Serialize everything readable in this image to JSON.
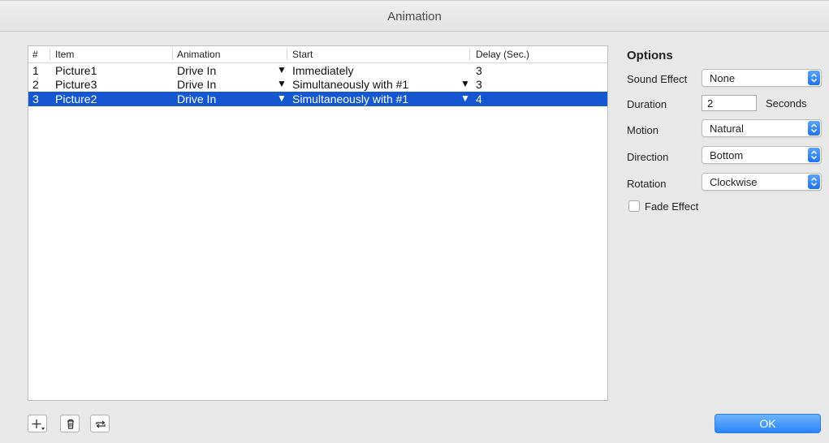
{
  "window": {
    "title": "Animation"
  },
  "table": {
    "columns": [
      "#",
      "Item",
      "Animation",
      "Start",
      "Delay (Sec.)"
    ],
    "rows": [
      {
        "num": "1",
        "item": "Picture1",
        "animation": "Drive In",
        "start": "Immediately",
        "delay": "3",
        "start_arrow": false,
        "selected": false
      },
      {
        "num": "2",
        "item": "Picture3",
        "animation": "Drive In",
        "start": "Simultaneously with #1",
        "delay": "3",
        "start_arrow": true,
        "selected": false
      },
      {
        "num": "3",
        "item": "Picture2",
        "animation": "Drive In",
        "start": "Simultaneously with #1",
        "delay": "4",
        "start_arrow": true,
        "selected": true
      }
    ],
    "dropdown_glyph": "▼"
  },
  "options": {
    "title": "Options",
    "sound_effect": {
      "label": "Sound Effect",
      "value": "None"
    },
    "duration": {
      "label": "Duration",
      "value": "2",
      "unit": "Seconds"
    },
    "motion": {
      "label": "Motion",
      "value": "Natural"
    },
    "direction": {
      "label": "Direction",
      "value": "Bottom"
    },
    "rotation": {
      "label": "Rotation",
      "value": "Clockwise"
    },
    "fade_effect": {
      "label": "Fade Effect",
      "checked": false
    }
  },
  "buttons": {
    "ok": "OK"
  },
  "icons": {
    "add": "add-icon",
    "delete": "trash-icon",
    "repeat": "repeat-icon",
    "popup": "chevron-updown-icon"
  },
  "colors": {
    "selection": "#1557d1",
    "accent": "#2a84f7"
  }
}
